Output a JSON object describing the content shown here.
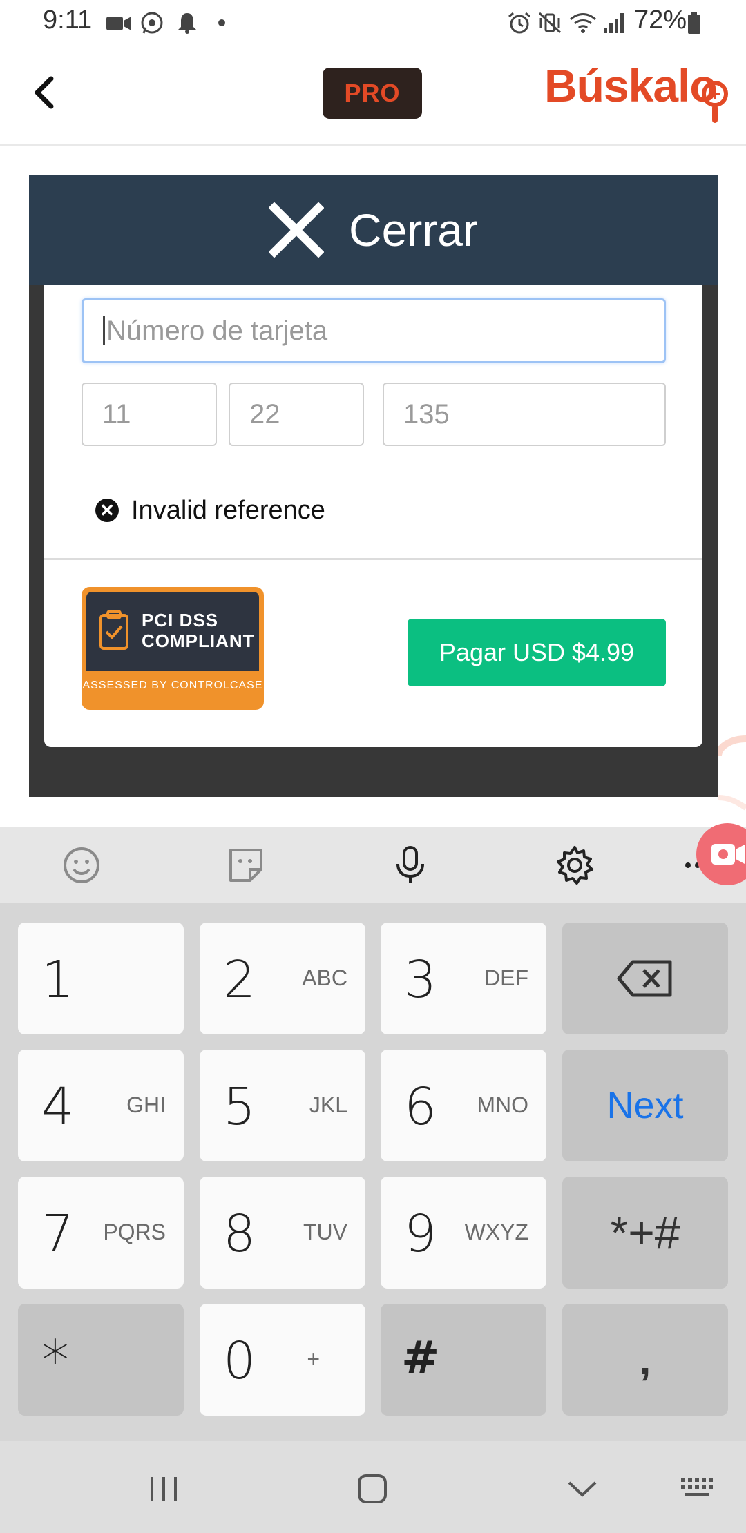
{
  "status_bar": {
    "time": "9:11",
    "battery": "72%"
  },
  "header": {
    "pro_label": "PRO",
    "logo_text": "Búskalo",
    "brand_color": "#e34a26"
  },
  "modal": {
    "close_label": "Cerrar",
    "card_number_placeholder": "Número de tarjeta",
    "month_placeholder": "11",
    "year_placeholder": "22",
    "cvv_placeholder": "135",
    "error_text": "Invalid reference",
    "pci_line1": "PCI DSS",
    "pci_line2": "COMPLIANT",
    "pci_sub": "ASSESSED BY CONTROLCASE",
    "pay_label": "Pagar USD $4.99",
    "pay_color": "#0bbf81"
  },
  "keyboard": {
    "keys": [
      {
        "num": "1",
        "letters": ""
      },
      {
        "num": "2",
        "letters": "ABC"
      },
      {
        "num": "3",
        "letters": "DEF"
      },
      {
        "num": "4",
        "letters": "GHI"
      },
      {
        "num": "5",
        "letters": "JKL"
      },
      {
        "num": "6",
        "letters": "MNO"
      },
      {
        "num": "7",
        "letters": "PQRS"
      },
      {
        "num": "8",
        "letters": "TUV"
      },
      {
        "num": "9",
        "letters": "WXYZ"
      },
      {
        "num": "0",
        "letters": "+"
      }
    ],
    "next_label": "Next",
    "symbols_label": "*+#",
    "star_label": "*",
    "hash_label": "#",
    "comma_label": ",",
    "next_color": "#1a73e8"
  }
}
